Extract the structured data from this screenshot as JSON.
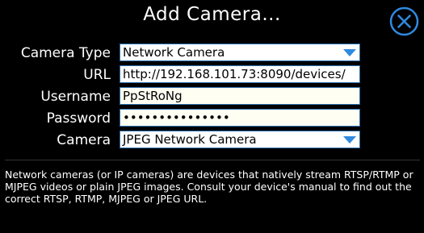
{
  "dialog": {
    "title": "Add Camera...",
    "close_icon": "close-circle-icon",
    "accent_color": "#2f8ae0"
  },
  "form": {
    "camera_type": {
      "label": "Camera Type",
      "value": "Network Camera"
    },
    "url": {
      "label": "URL",
      "value": "http://192.168.101.73:8090/devices/"
    },
    "username": {
      "label": "Username",
      "value": "PpStRoNg"
    },
    "password": {
      "label": "Password",
      "value": "•••••••••••••••"
    },
    "camera": {
      "label": "Camera",
      "value": "JPEG Network Camera"
    }
  },
  "description": "Network cameras (or IP cameras) are devices that natively stream RTSP/RTMP or MJPEG videos or plain JPEG images. Consult your device's manual to find out the correct RTSP, RTMP, MJPEG or JPEG URL."
}
